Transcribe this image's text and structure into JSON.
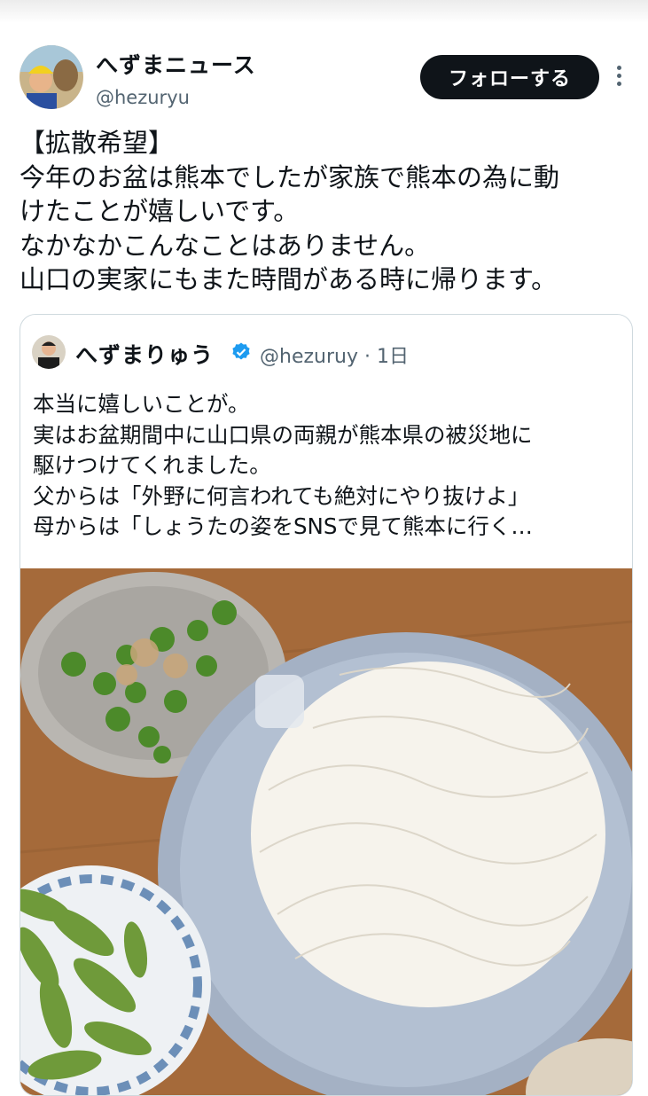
{
  "author": {
    "display_name": "へずまニュース",
    "handle": "@hezuryu"
  },
  "follow_label": "フォローする",
  "tweet_lines": [
    "【拡散希望】",
    "今年のお盆は熊本でしたが家族で熊本の為に動",
    "けたことが嬉しいです。",
    "なかなかこんなことはありません。",
    "山口の実家にもまた時間がある時に帰ります。"
  ],
  "quoted": {
    "display_name": "へずまりゅう",
    "handle_time": "@hezuruy · 1日",
    "lines": [
      "本当に嬉しいことが。",
      "実はお盆期間中に山口県の両親が熊本県の被災地に",
      "駆けつけてくれました。",
      "父からは「外野に何言われても絶対にやり抜けよ」",
      "母からは「しょうたの姿をSNSで見て熊本に行く…"
    ]
  },
  "colors": {
    "text": "#0f1419",
    "secondary": "#536471",
    "verified": "#1d9bf0",
    "border": "#cfd9de",
    "follow_bg": "#0f1419"
  }
}
